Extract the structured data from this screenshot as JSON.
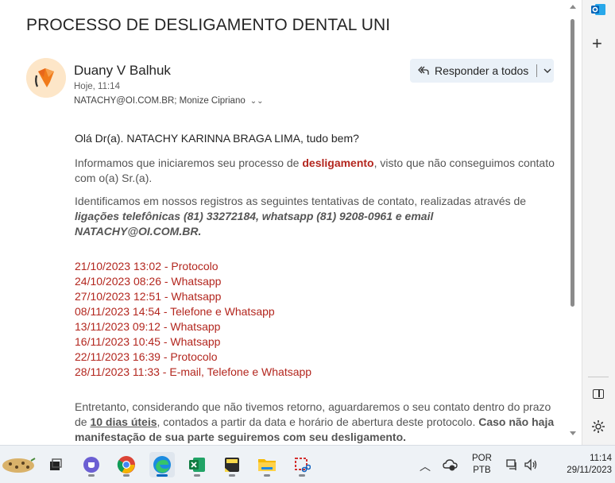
{
  "email": {
    "subject": "PROCESSO DE DESLIGAMENTO DENTAL UNI",
    "sender": "Duany V Balhuk",
    "time": "Hoje, 11:14",
    "recipients": "NATACHY@OI.COM.BR; Monize Cipriano",
    "reply_all_label": "Responder a todos"
  },
  "body": {
    "greeting": "Olá Dr(a). NATACHY KARINNA BRAGA LIMA, tudo bem?",
    "p1_before": "Informamos que iniciaremos seu processo de ",
    "p1_highlight": "desligamento",
    "p1_after": ", visto que não conseguimos contato com o(a) Sr.(a).",
    "p2_before": "Identificamos em nossos registros as seguintes tentativas de contato, realizadas através de ",
    "p2_bold": "ligações telefônicas (81) 33272184, whatsapp (81) 9208-0961 e email NATACHY@OI.COM.BR",
    "p2_after": ".",
    "attempts": [
      "21/10/2023 13:02 - Protocolo",
      "24/10/2023 08:26 - Whatsapp",
      "27/10/2023 12:51 - Whatsapp",
      "08/11/2023 14:54 - Telefone e Whatsapp",
      "13/11/2023 09:12 - Whatsapp",
      "16/11/2023 10:45 - Whatsapp",
      "22/11/2023 16:39 - Protocolo",
      "28/11/2023 11:33 - E-mail, Telefone e Whatsapp"
    ],
    "p3_before": "Entretanto, considerando que não tivemos retorno, aguardaremos o seu contato dentro do prazo de ",
    "p3_underline": "10 dias úteis",
    "p3_middle": ", contados a partir da data e horário de abertura deste protocolo. ",
    "p3_bold": "Caso não haja manifestação de sua parte seguiremos com seu desligamento."
  },
  "taskbar": {
    "apps": [
      "widgets-icon",
      "task-view-icon",
      "teams-icon",
      "chrome-icon",
      "edge-icon",
      "excel-icon",
      "sticky-notes-icon",
      "file-explorer-icon",
      "snipping-tool-icon"
    ],
    "lang_top": "POR",
    "lang_bottom": "PTB",
    "time": "11:14",
    "date": "29/11/2023"
  },
  "colors": {
    "accent": "#0067c0",
    "red_text": "#b3261e",
    "reply_bg": "#eaf1f8"
  }
}
